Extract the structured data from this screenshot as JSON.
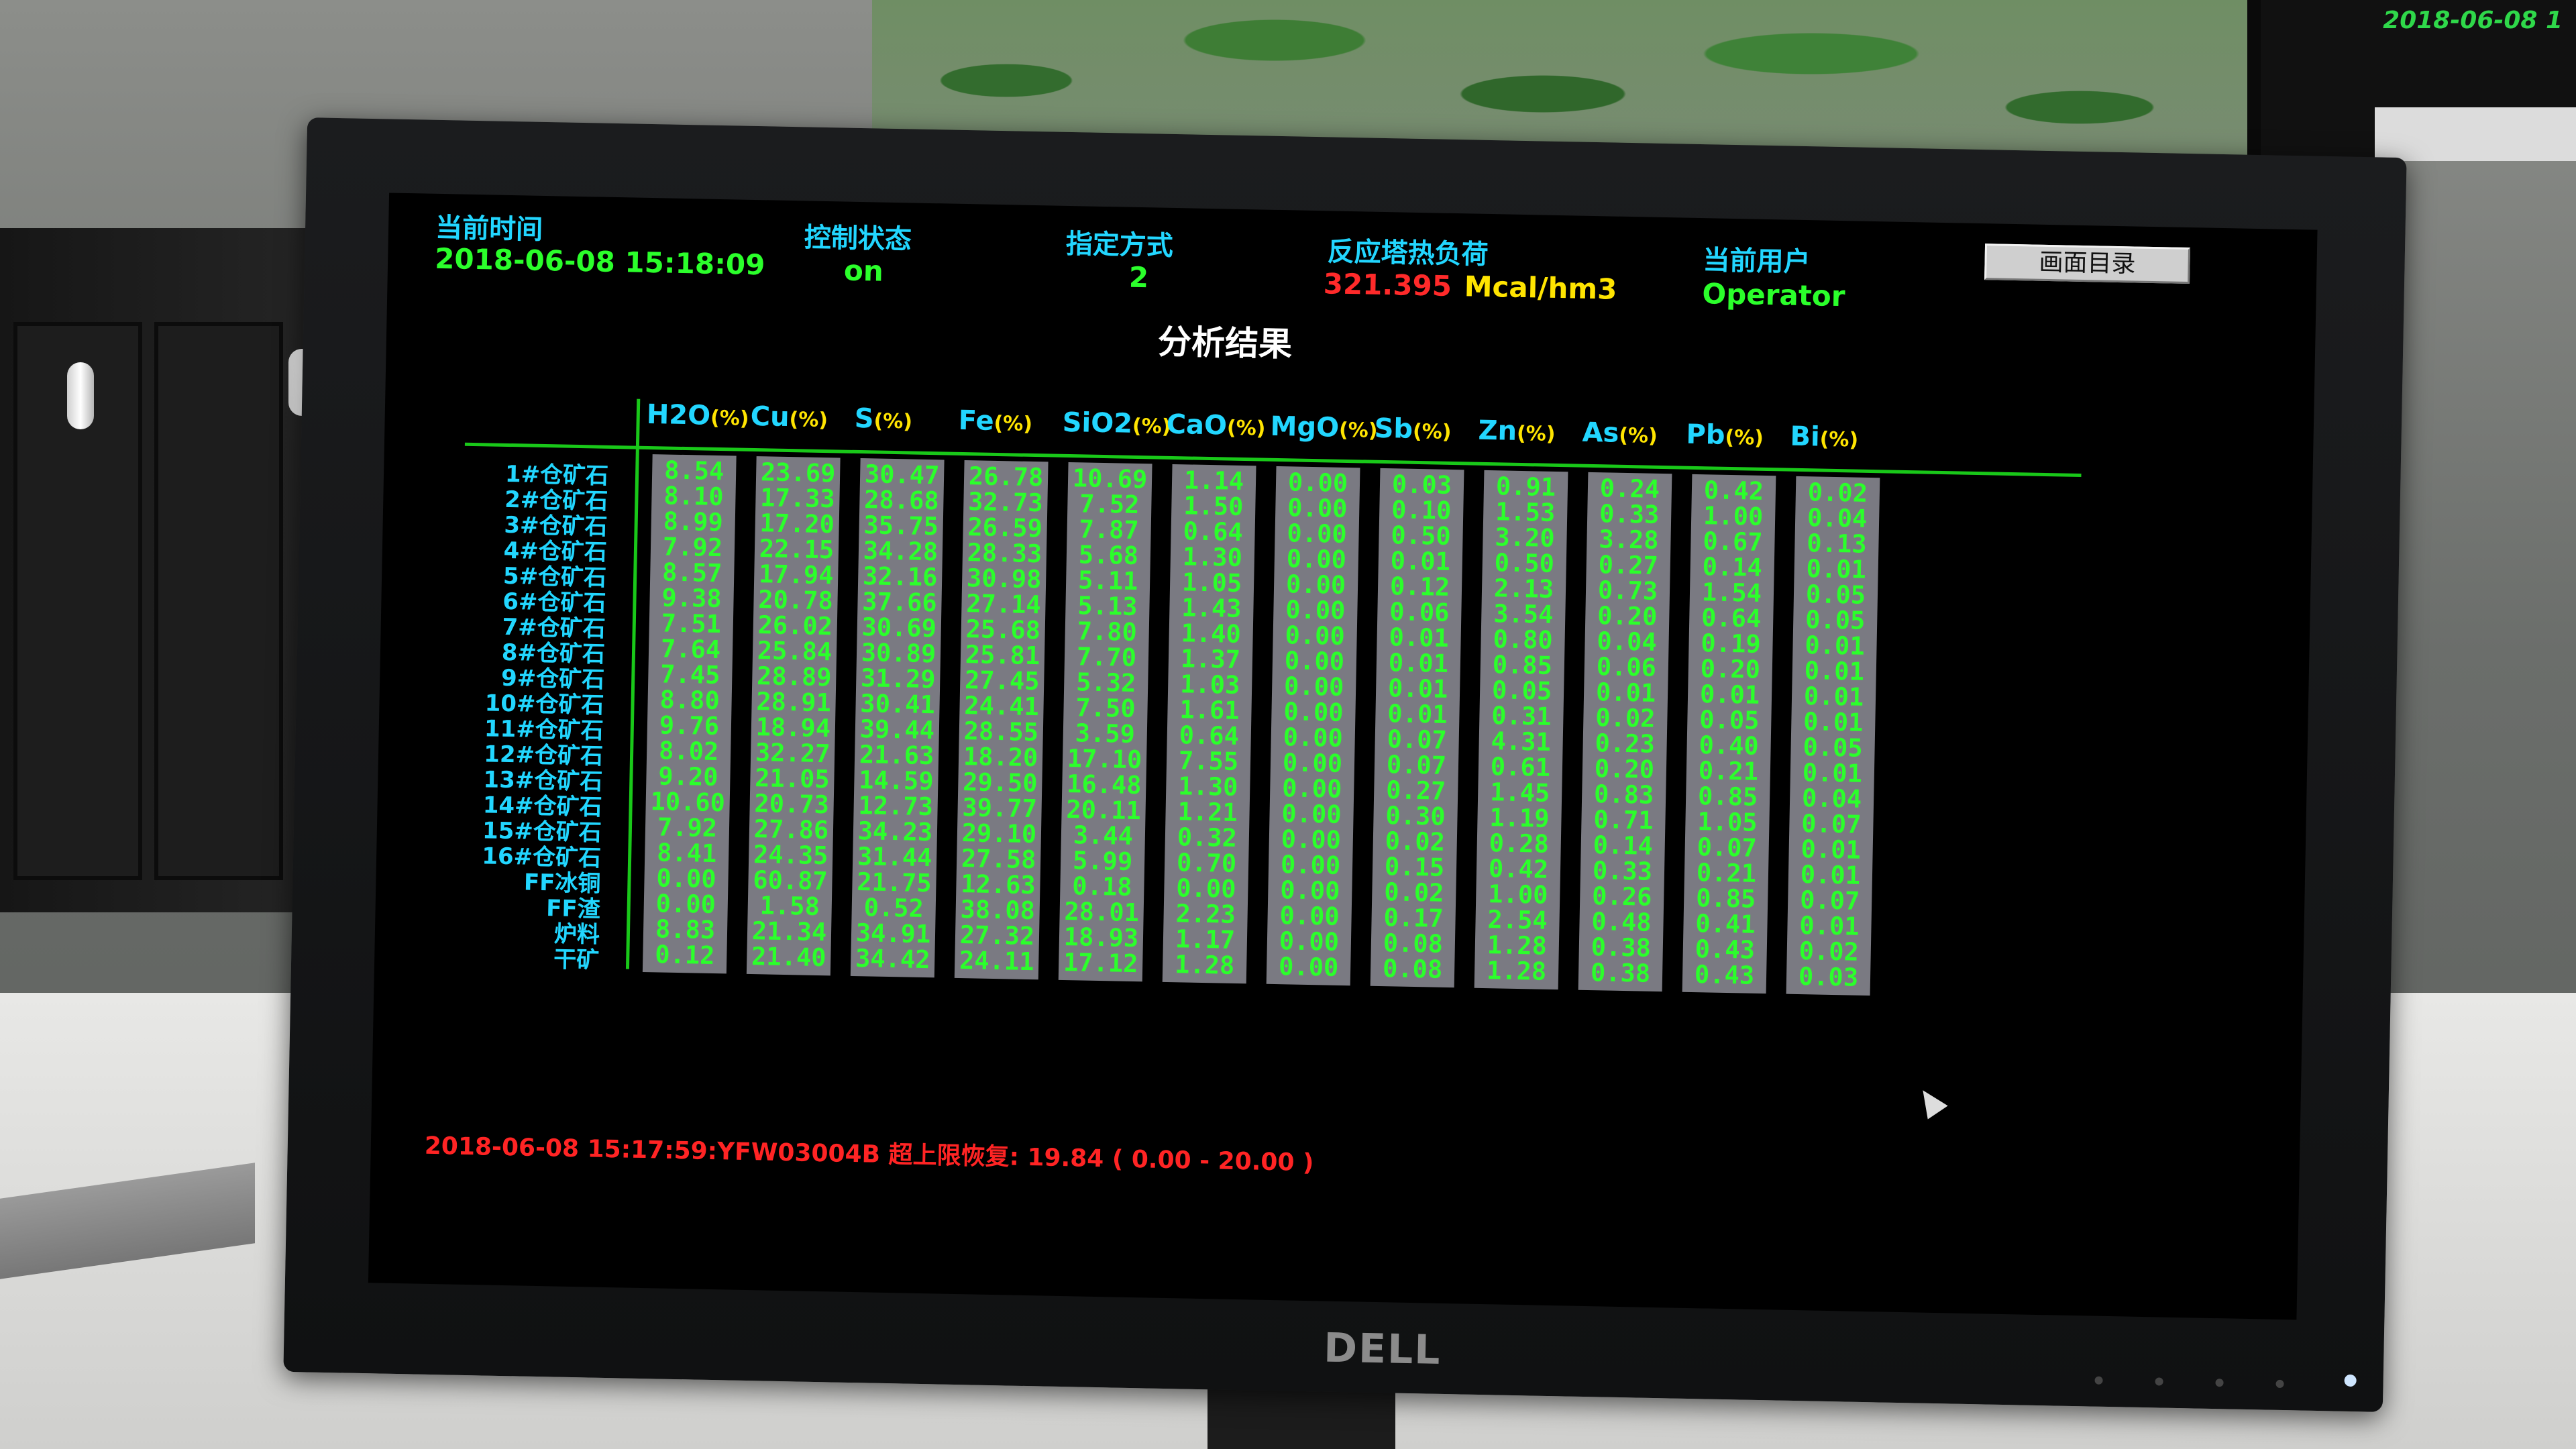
{
  "header": {
    "time_label": "当前时间",
    "time_value": "2018-06-08 15:18:09",
    "control_label": "控制状态",
    "control_value": "on",
    "mode_label": "指定方式",
    "mode_value": "2",
    "load_label": "反应塔热负荷",
    "load_value": "321.395",
    "load_unit": "Mcal/hm3",
    "user_label": "当前用户",
    "user_value": "Operator",
    "menu_button": "画面目录"
  },
  "title": "分析结果",
  "unit_suffix": "(%)",
  "columns": [
    "H2O",
    "Cu",
    "S",
    "Fe",
    "SiO2",
    "CaO",
    "MgO",
    "Sb",
    "Zn",
    "As",
    "Pb",
    "Bi"
  ],
  "rows": [
    {
      "label": "1#仓矿石",
      "values": [
        "8.54",
        "23.69",
        "30.47",
        "26.78",
        "10.69",
        "1.14",
        "0.00",
        "0.03",
        "0.91",
        "0.24",
        "0.42",
        "0.02"
      ]
    },
    {
      "label": "2#仓矿石",
      "values": [
        "8.10",
        "17.33",
        "28.68",
        "32.73",
        "7.52",
        "1.50",
        "0.00",
        "0.10",
        "1.53",
        "0.33",
        "1.00",
        "0.04"
      ]
    },
    {
      "label": "3#仓矿石",
      "values": [
        "8.99",
        "17.20",
        "35.75",
        "26.59",
        "7.87",
        "0.64",
        "0.00",
        "0.50",
        "3.20",
        "3.28",
        "0.67",
        "0.13"
      ]
    },
    {
      "label": "4#仓矿石",
      "values": [
        "7.92",
        "22.15",
        "34.28",
        "28.33",
        "5.68",
        "1.30",
        "0.00",
        "0.01",
        "0.50",
        "0.27",
        "0.14",
        "0.01"
      ]
    },
    {
      "label": "5#仓矿石",
      "values": [
        "8.57",
        "17.94",
        "32.16",
        "30.98",
        "5.11",
        "1.05",
        "0.00",
        "0.12",
        "2.13",
        "0.73",
        "1.54",
        "0.05"
      ]
    },
    {
      "label": "6#仓矿石",
      "values": [
        "9.38",
        "20.78",
        "37.66",
        "27.14",
        "5.13",
        "1.43",
        "0.00",
        "0.06",
        "3.54",
        "0.20",
        "0.64",
        "0.05"
      ]
    },
    {
      "label": "7#仓矿石",
      "values": [
        "7.51",
        "26.02",
        "30.69",
        "25.68",
        "7.80",
        "1.40",
        "0.00",
        "0.01",
        "0.80",
        "0.04",
        "0.19",
        "0.01"
      ]
    },
    {
      "label": "8#仓矿石",
      "values": [
        "7.64",
        "25.84",
        "30.89",
        "25.81",
        "7.70",
        "1.37",
        "0.00",
        "0.01",
        "0.85",
        "0.06",
        "0.20",
        "0.01"
      ]
    },
    {
      "label": "9#仓矿石",
      "values": [
        "7.45",
        "28.89",
        "31.29",
        "27.45",
        "5.32",
        "1.03",
        "0.00",
        "0.01",
        "0.05",
        "0.01",
        "0.01",
        "0.01"
      ]
    },
    {
      "label": "10#仓矿石",
      "values": [
        "8.80",
        "28.91",
        "30.41",
        "24.41",
        "7.50",
        "1.61",
        "0.00",
        "0.01",
        "0.31",
        "0.02",
        "0.05",
        "0.01"
      ]
    },
    {
      "label": "11#仓矿石",
      "values": [
        "9.76",
        "18.94",
        "39.44",
        "28.55",
        "3.59",
        "0.64",
        "0.00",
        "0.07",
        "4.31",
        "0.23",
        "0.40",
        "0.05"
      ]
    },
    {
      "label": "12#仓矿石",
      "values": [
        "8.02",
        "32.27",
        "21.63",
        "18.20",
        "17.10",
        "7.55",
        "0.00",
        "0.07",
        "0.61",
        "0.20",
        "0.21",
        "0.01"
      ]
    },
    {
      "label": "13#仓矿石",
      "values": [
        "9.20",
        "21.05",
        "14.59",
        "29.50",
        "16.48",
        "1.30",
        "0.00",
        "0.27",
        "1.45",
        "0.83",
        "0.85",
        "0.04"
      ]
    },
    {
      "label": "14#仓矿石",
      "values": [
        "10.60",
        "20.73",
        "12.73",
        "39.77",
        "20.11",
        "1.21",
        "0.00",
        "0.30",
        "1.19",
        "0.71",
        "1.05",
        "0.07"
      ]
    },
    {
      "label": "15#仓矿石",
      "values": [
        "7.92",
        "27.86",
        "34.23",
        "29.10",
        "3.44",
        "0.32",
        "0.00",
        "0.02",
        "0.28",
        "0.14",
        "0.07",
        "0.01"
      ]
    },
    {
      "label": "16#仓矿石",
      "values": [
        "8.41",
        "24.35",
        "31.44",
        "27.58",
        "5.99",
        "0.70",
        "0.00",
        "0.15",
        "0.42",
        "0.33",
        "0.21",
        "0.01"
      ]
    },
    {
      "label": "FF冰铜",
      "values": [
        "0.00",
        "60.87",
        "21.75",
        "12.63",
        "0.18",
        "0.00",
        "0.00",
        "0.02",
        "1.00",
        "0.26",
        "0.85",
        "0.07"
      ]
    },
    {
      "label": "FF渣",
      "values": [
        "0.00",
        "1.58",
        "0.52",
        "38.08",
        "28.01",
        "2.23",
        "0.00",
        "0.17",
        "2.54",
        "0.48",
        "0.41",
        "0.01"
      ]
    },
    {
      "label": "炉料",
      "values": [
        "8.83",
        "21.34",
        "34.91",
        "27.32",
        "18.93",
        "1.17",
        "0.00",
        "0.08",
        "1.28",
        "0.38",
        "0.43",
        "0.02"
      ]
    },
    {
      "label": "干矿",
      "values": [
        "0.12",
        "21.40",
        "34.42",
        "24.11",
        "17.12",
        "1.28",
        "0.00",
        "0.08",
        "1.28",
        "0.38",
        "0.43",
        "0.03"
      ]
    }
  ],
  "alarm_text": "2018-06-08 15:17:59:YFW03004B 超上限恢复:  19.84  ( 0.00 - 20.00 )",
  "monitor_brand": "DELL",
  "background_monitor_date": "2018-06-08 1",
  "colors": {
    "label_cyan": "#22d6ff",
    "value_green": "#2bff2b",
    "load_red": "#ff2a2a",
    "unit_yellow": "#ffe400",
    "alarm_red": "#ff2424",
    "column_gray": "#7a7a82"
  }
}
